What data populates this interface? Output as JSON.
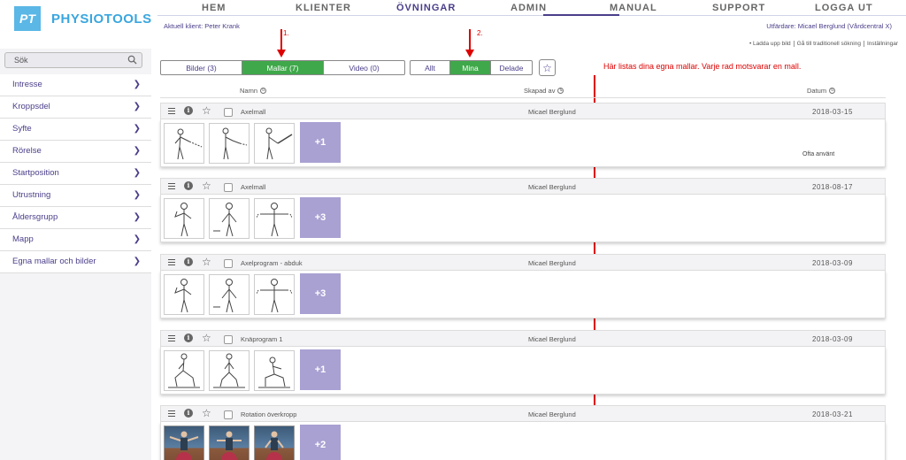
{
  "logo": {
    "badge": "PT",
    "name": "PHYSIOTOOLS"
  },
  "nav": {
    "items": [
      "HEM",
      "KLIENTER",
      "ÖVNINGAR",
      "ADMIN",
      "MANUAL",
      "SUPPORT",
      "LOGGA UT"
    ],
    "active": "ÖVNINGAR"
  },
  "client_label": "Aktuell klient: Peter Krank",
  "issuer_label": "Utfärdare: Micael Berglund (Vårdcentral X)",
  "top_links": [
    "• Ladda upp bild",
    "Gå till traditionell sökning",
    "Inställningar"
  ],
  "sidebar": {
    "search_label": "Sök",
    "items": [
      "Intresse",
      "Kroppsdel",
      "Syfte",
      "Rörelse",
      "Startposition",
      "Utrustning",
      "Åldersgrupp",
      "Mapp",
      "Egna mallar och bilder"
    ]
  },
  "tabs_type": [
    "Bilder (3)",
    "Mallar (7)",
    "Video (0)"
  ],
  "tabs_scope": [
    "Allt",
    "Mina",
    "Delade"
  ],
  "annotations": {
    "one": "1.",
    "two": "2.",
    "text": "Här listas dina egna mallar. Varje rad motsvarar en mall."
  },
  "columns": {
    "name": "Namn",
    "created_by": "Skapad av",
    "date": "Datum"
  },
  "rows": [
    {
      "name": "Axelmall",
      "author": "Micael Berglund",
      "date": "2018-03-15",
      "more": "+1",
      "note": "Ofta använt"
    },
    {
      "name": "Axelmall",
      "author": "Micael Berglund",
      "date": "2018-08-17",
      "more": "+3",
      "note": ""
    },
    {
      "name": "Axelprogram - abduk",
      "author": "Micael Berglund",
      "date": "2018-03-09",
      "more": "+3",
      "note": ""
    },
    {
      "name": "Knäprogram 1",
      "author": "Micael Berglund",
      "date": "2018-03-09",
      "more": "+1",
      "note": ""
    },
    {
      "name": "Rotation överkropp",
      "author": "Micael Berglund",
      "date": "2018-03-21",
      "more": "+2",
      "note": ""
    }
  ],
  "colors": {
    "accent": "#4a3f8a",
    "active_tab": "#3fa84a",
    "logo": "#3aa6df",
    "more_tile": "#a9a1d2",
    "annotation": "#dd0000"
  }
}
